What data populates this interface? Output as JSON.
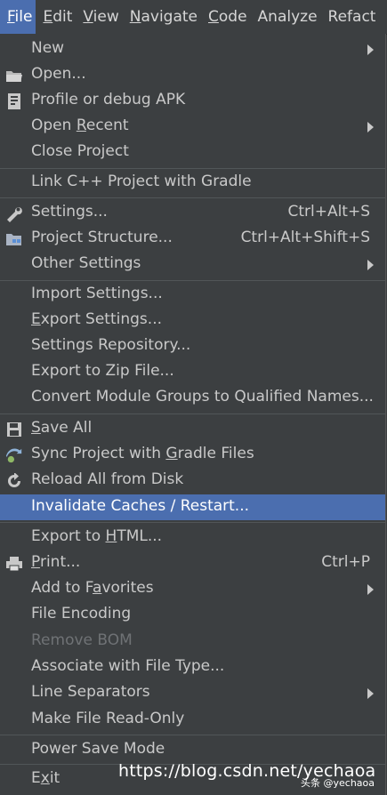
{
  "menubar": {
    "items": [
      {
        "mn": "F",
        "rest": "ile"
      },
      {
        "mn": "E",
        "rest": "dit"
      },
      {
        "mn": "V",
        "rest": "iew"
      },
      {
        "mn": "N",
        "rest": "avigate"
      },
      {
        "mn": "C",
        "rest": "ode"
      },
      {
        "mn": "",
        "rest": "Analyze"
      },
      {
        "mn": "",
        "rest": "Refact"
      }
    ]
  },
  "menu": {
    "new": {
      "label": "New"
    },
    "open": {
      "label": "Open...",
      "icon": "folder-icon"
    },
    "profile": {
      "label": "Profile or debug APK",
      "icon": "apk-icon"
    },
    "open_recent": {
      "pre": "Open ",
      "mn": "R",
      "post": "ecent"
    },
    "close_project": {
      "label": "Close Project"
    },
    "link_cpp": {
      "label": "Link C++ Project with Gradle"
    },
    "settings": {
      "label": "Settings...",
      "shortcut": "Ctrl+Alt+S",
      "icon": "wrench-icon"
    },
    "project_structure": {
      "label": "Project Structure...",
      "shortcut": "Ctrl+Alt+Shift+S",
      "icon": "project-structure-icon"
    },
    "other_settings": {
      "label": "Other Settings"
    },
    "import_settings": {
      "label": "Import Settings..."
    },
    "export_settings": {
      "mn": "E",
      "post": "xport Settings..."
    },
    "settings_repository": {
      "label": "Settings Repository..."
    },
    "export_zip": {
      "label": "Export to Zip File..."
    },
    "convert_module": {
      "label": "Convert Module Groups to Qualified Names..."
    },
    "save_all": {
      "mn": "S",
      "post": "ave All",
      "icon": "save-icon"
    },
    "sync_project": {
      "pre": "Sync Project with ",
      "mn": "G",
      "post": "radle Files",
      "icon": "sync-icon"
    },
    "reload_all": {
      "label": "Reload All from Disk",
      "icon": "reload-icon"
    },
    "invalidate_caches": {
      "label": "Invalidate Caches / Restart..."
    },
    "export_html": {
      "pre": "Export to ",
      "mn": "H",
      "post": "TML..."
    },
    "print": {
      "mn": "P",
      "post": "rint...",
      "shortcut": "Ctrl+P",
      "icon": "printer-icon"
    },
    "add_favorites": {
      "pre": "Add to F",
      "mn": "a",
      "post": "vorites"
    },
    "file_encoding": {
      "label": "File Encoding"
    },
    "remove_bom": {
      "label": "Remove BOM"
    },
    "associate": {
      "label": "Associate with File Type..."
    },
    "line_separators": {
      "label": "Line Separators"
    },
    "make_readonly": {
      "label": "Make File Read-Only"
    },
    "power_save": {
      "label": "Power Save Mode"
    },
    "exit": {
      "pre": "E",
      "mn": "x",
      "post": "it"
    }
  },
  "watermark": {
    "url": "https://blog.csdn.net/yechaoa",
    "tag": "头条 @yechaoa"
  },
  "colors": {
    "selection": "#4b6eaf",
    "background": "#3c3f41",
    "disabled": "#6f7275"
  }
}
